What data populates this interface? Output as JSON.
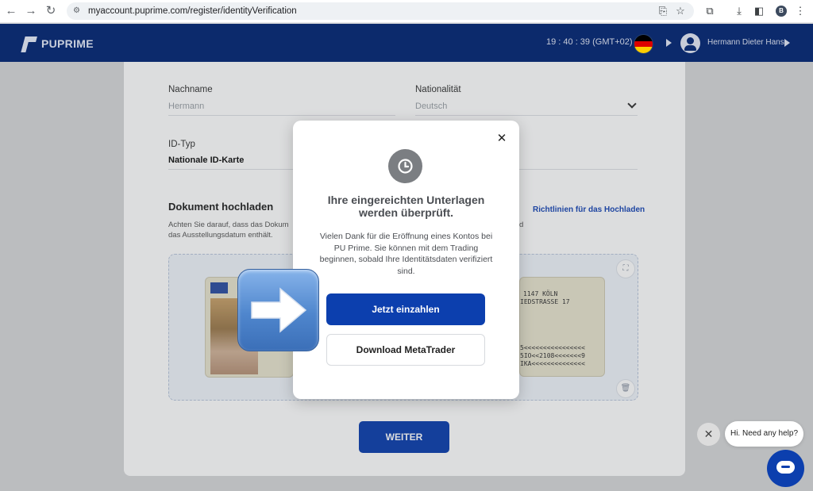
{
  "browser": {
    "url": "myaccount.puprime.com/register/identityVerification",
    "profile_initial": "B"
  },
  "header": {
    "logo_text": "PUPRIME",
    "clock": "19 : 40 : 39 (GMT+02)",
    "user_name": "Hermann Dieter Hans",
    "flag_colors": [
      "#000000",
      "#dd0000",
      "#ffce00"
    ]
  },
  "form": {
    "last_name_label": "Nachname",
    "last_name_value": "Hermann",
    "nationality_label": "Nationalität",
    "nationality_value": "Deutsch",
    "id_type_label": "ID-Typ",
    "id_type_value": "Nationale ID-Karte",
    "upload_title": "Dokument hochladen",
    "upload_hint_line1": "Achten Sie darauf, dass das Dokum",
    "upload_hint_line2": "das Ausstellungsdatum enthält.",
    "upload_hint_tail": "d",
    "guidelines_link": "Richtlinien für das Hochladen",
    "card_text_a": "1147 KÖLN",
    "card_text_b": "IEDSTRASSE 17",
    "mrz_lines": [
      "5<<<<<<<<<<<<<<<<",
      "5IO<<2108<<<<<<<9",
      "IKA<<<<<<<<<<<<<<"
    ],
    "continue_button": "WEITER"
  },
  "modal": {
    "title": "Ihre eingereichten Unterlagen werden überprüft.",
    "body": "Vielen Dank für die Eröffnung eines Kontos bei PU Prime. Sie können mit dem Trading beginnen, sobald Ihre Identitätsdaten verifiziert sind.",
    "primary_button": "Jetzt einzahlen",
    "secondary_button": "Download MetaTrader",
    "accent_color": "#0c3fae"
  },
  "chat": {
    "greeting": "Hi. Need any help?"
  }
}
